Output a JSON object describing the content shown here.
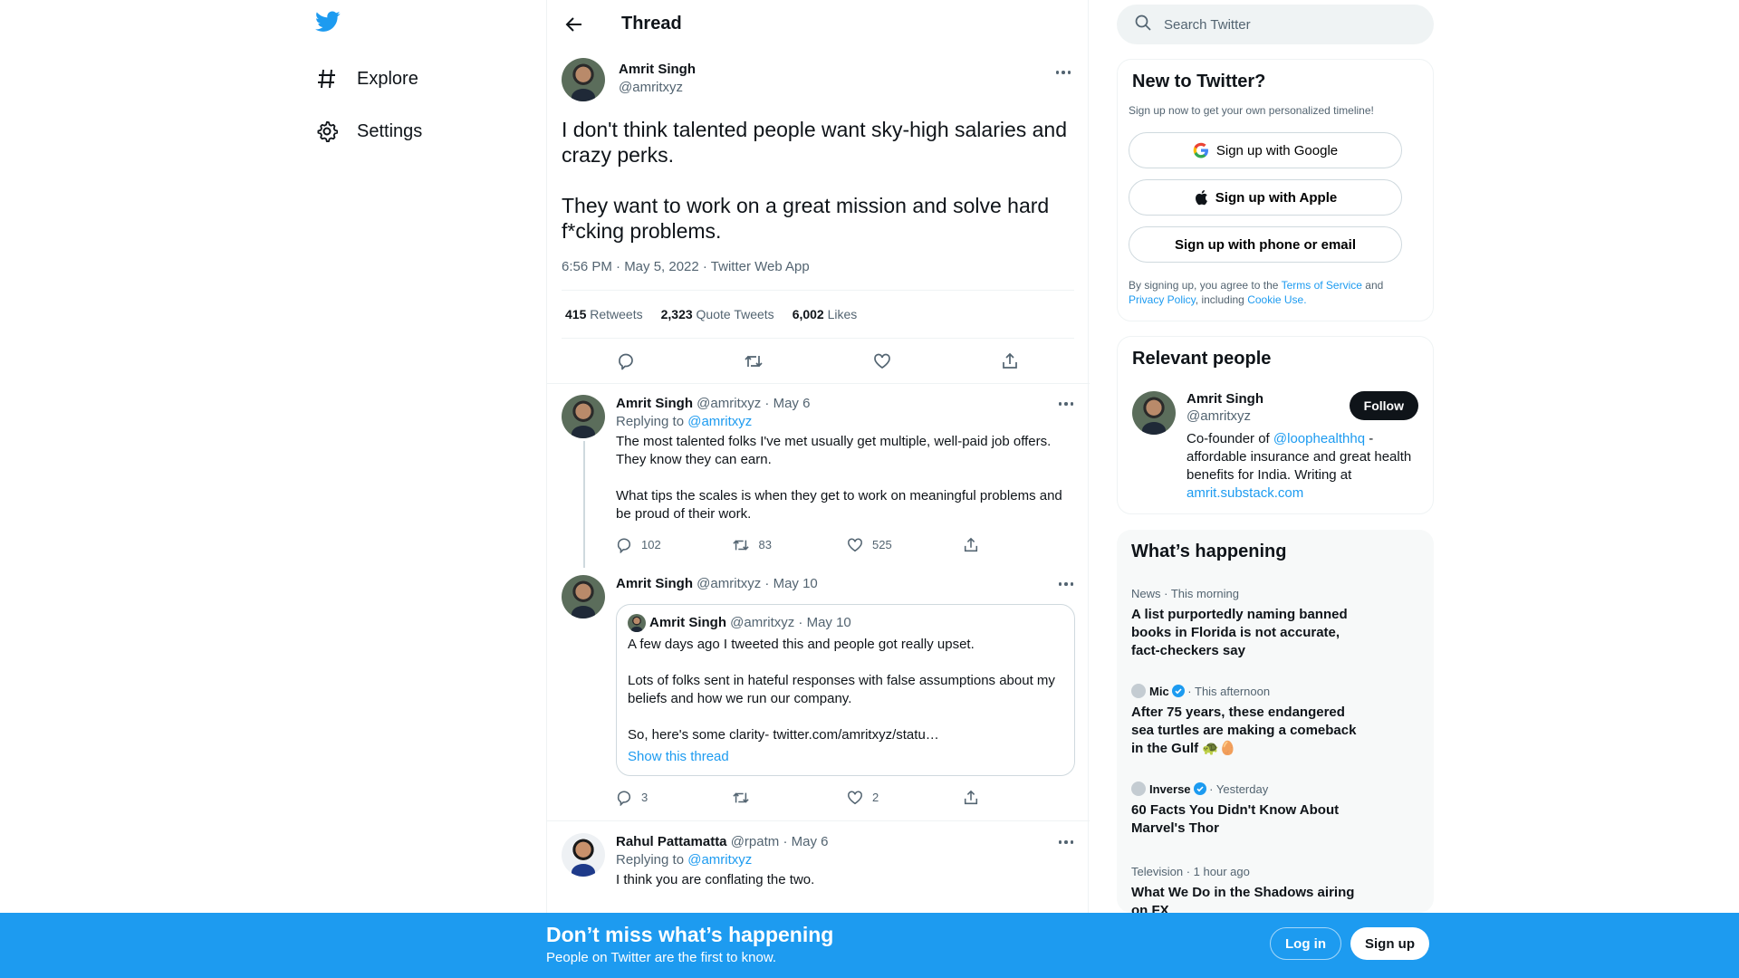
{
  "nav": {
    "explore_label": "Explore",
    "settings_label": "Settings"
  },
  "header": {
    "title": "Thread"
  },
  "main_tweet": {
    "name": "Amrit Singh",
    "handle": "@amritxyz",
    "text": "I don't think talented people want sky-high salaries and crazy perks.\n\nThey want to work on a great mission and solve hard f*cking problems.",
    "meta": "6:56 PM · May 5, 2022 · Twitter Web App",
    "retweets": "415",
    "retweets_label": "Retweets",
    "quotes": "2,323",
    "quotes_label": "Quote Tweets",
    "likes": "6,002",
    "likes_label": "Likes"
  },
  "replies": [
    {
      "name": "Amrit Singh",
      "handle": "@amritxyz",
      "date": "· May 6",
      "replying_prefix": "Replying to",
      "replying_to": "@amritxyz",
      "text": "The most talented folks I've met usually get multiple, well-paid job offers. They know they can earn.\n\nWhat tips the scales is when they get to work on meaningful problems and be proud of their work.",
      "replies": "102",
      "retweets": "83",
      "likes": "525"
    },
    {
      "name": "Amrit Singh",
      "handle": "@amritxyz",
      "date": "· May 10",
      "quote": {
        "name": "Amrit Singh",
        "handle": "@amritxyz",
        "date": "· May 10",
        "text": "A few days ago I tweeted this and people got really upset.\n\nLots of folks sent in hateful responses with false assumptions about my beliefs and how we run our company.\n\nSo, here's some clarity- twitter.com/amritxyz/statu…",
        "show_thread": "Show this thread"
      },
      "replies": "3",
      "retweets": "",
      "likes": "2"
    },
    {
      "name": "Rahul Pattamatta",
      "handle": "@rpatm",
      "date": "· May 6",
      "replying_prefix": "Replying to",
      "replying_to": "@amritxyz",
      "text": "I think you are conflating the two."
    }
  ],
  "search": {
    "placeholder": "Search Twitter"
  },
  "new_to_twitter": {
    "title": "New to Twitter?",
    "subtitle": "Sign up now to get your own personalized timeline!",
    "google": "Sign up with Google",
    "apple": "Sign up with Apple",
    "phone": "Sign up with phone or email",
    "legal_prefix": "By signing up, you agree to the",
    "terms": "Terms of Service",
    "and": "and",
    "privacy": "Privacy Policy",
    "including": ", including",
    "cookie": "Cookie Use."
  },
  "relevant_people": {
    "title": "Relevant people",
    "name": "Amrit Singh",
    "handle": "@amritxyz",
    "follow": "Follow",
    "bio_prefix": "Co-founder of",
    "bio_link": "@loophealthhq",
    "bio_rest": "- affordable insurance and great health benefits for India. Writing at",
    "bio_url": "amrit.substack.com"
  },
  "happening": {
    "title": "What’s happening",
    "trends": [
      {
        "source": "News",
        "time": "· This morning",
        "headline": "A list purportedly naming banned books in Florida is not accurate, fact-checkers say"
      },
      {
        "source": "Mic",
        "time": "· This afternoon",
        "headline": "After 75 years, these endangered sea turtles are making a comeback in the Gulf 🐢🥚"
      },
      {
        "source": "Inverse",
        "time": "· Yesterday",
        "headline": "60 Facts You Didn't Know About Marvel's Thor"
      },
      {
        "source": "Television",
        "time": "· 1 hour ago",
        "headline": "What We Do in the Shadows airing on FX"
      }
    ]
  },
  "bottom_bar": {
    "title": "Don’t miss what’s happening",
    "subtitle": "People on Twitter are the first to know.",
    "login": "Log in",
    "signup": "Sign up"
  },
  "colors": {
    "accent": "#1d9bf0",
    "text": "#0f1419",
    "muted": "#536471"
  }
}
